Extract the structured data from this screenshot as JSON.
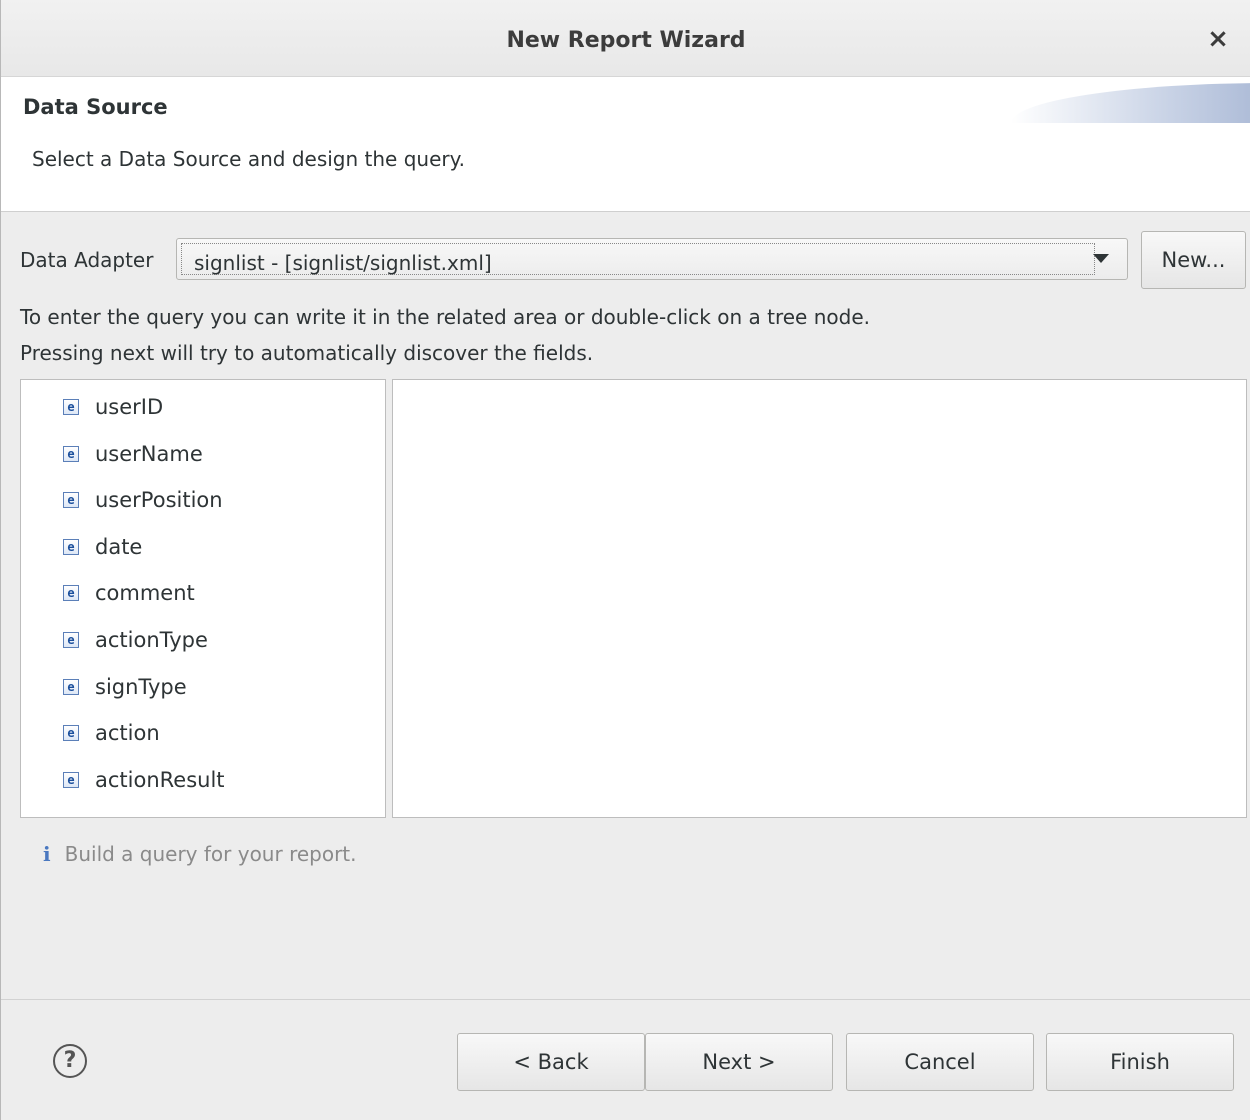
{
  "window": {
    "title": "New Report Wizard",
    "close_glyph": "×"
  },
  "header": {
    "title": "Data Source",
    "description": "Select a Data Source and design the query."
  },
  "adapter": {
    "label": "Data Adapter",
    "value": "signlist - [signlist/signlist.xml]",
    "new_button": "New..."
  },
  "hints": {
    "line1": "To enter the query you can write it in the related area or double-click on a tree node.",
    "line2": "Pressing next will try to automatically discover the fields."
  },
  "tree": {
    "icon_letter": "e",
    "items": [
      {
        "label": "userID"
      },
      {
        "label": "userName"
      },
      {
        "label": "userPosition"
      },
      {
        "label": "date"
      },
      {
        "label": "comment"
      },
      {
        "label": "actionType"
      },
      {
        "label": "signType"
      },
      {
        "label": "action"
      },
      {
        "label": "actionResult"
      }
    ]
  },
  "query": {
    "text": ""
  },
  "status": {
    "icon": "i",
    "message": "Build a query for your report."
  },
  "footer": {
    "help_glyph": "?",
    "back": "< Back",
    "next": "Next >",
    "cancel": "Cancel",
    "finish": "Finish"
  }
}
